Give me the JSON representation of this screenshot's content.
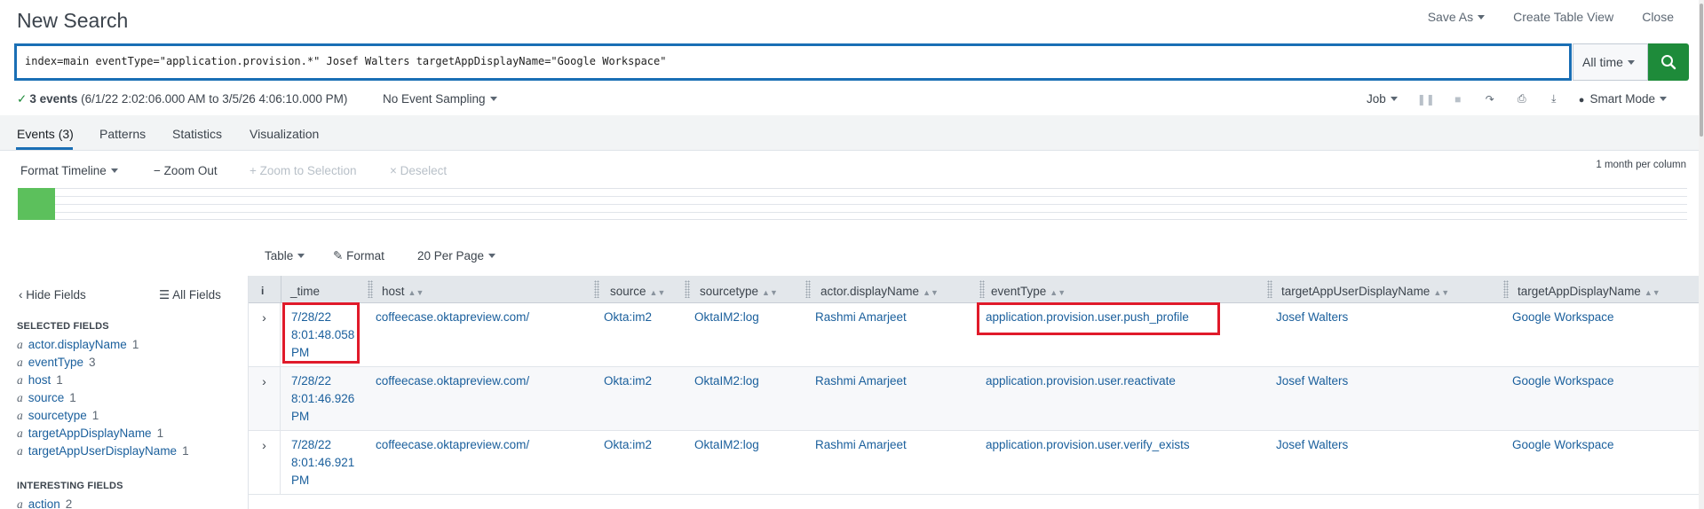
{
  "header": {
    "title": "New Search",
    "save_as": "Save As",
    "create_table_view": "Create Table View",
    "close": "Close"
  },
  "search": {
    "query": "index=main eventType=\"application.provision.*\" Josef Walters targetAppDisplayName=\"Google Workspace\"",
    "time_range": "All time"
  },
  "status": {
    "events_count": "3 events",
    "range": "(6/1/22 2:02:06.000 AM to 3/5/26 4:06:10.000 PM)",
    "sampling": "No Event Sampling",
    "job": "Job",
    "mode": "Smart Mode"
  },
  "tabs": [
    "Events (3)",
    "Patterns",
    "Statistics",
    "Visualization"
  ],
  "timeline": {
    "format": "Format Timeline",
    "zoom_out": "Zoom Out",
    "zoom_selection": "Zoom to Selection",
    "deselect": "Deselect",
    "per_column": "1 month per column"
  },
  "results_toolbar": {
    "view": "Table",
    "format": "Format",
    "per_page": "20 Per Page"
  },
  "fields_sidebar": {
    "hide": "Hide Fields",
    "all": "All Fields",
    "selected_title": "SELECTED FIELDS",
    "selected": [
      {
        "type": "a",
        "name": "actor.displayName",
        "count": "1"
      },
      {
        "type": "a",
        "name": "eventType",
        "count": "3"
      },
      {
        "type": "a",
        "name": "host",
        "count": "1"
      },
      {
        "type": "a",
        "name": "source",
        "count": "1"
      },
      {
        "type": "a",
        "name": "sourcetype",
        "count": "1"
      },
      {
        "type": "a",
        "name": "targetAppDisplayName",
        "count": "1"
      },
      {
        "type": "a",
        "name": "targetAppUserDisplayName",
        "count": "1"
      }
    ],
    "interesting_title": "INTERESTING FIELDS",
    "interesting": [
      {
        "type": "a",
        "name": "action",
        "count": "2"
      }
    ]
  },
  "table": {
    "info_header": "i",
    "columns": [
      "_time",
      "host",
      "source",
      "sourcetype",
      "actor.displayName",
      "eventType",
      "targetAppUserDisplayName",
      "targetAppDisplayName"
    ],
    "rows": [
      {
        "time": [
          "7/28/22",
          "8:01:48.058",
          "PM"
        ],
        "host": "coffeecase.oktapreview.com/",
        "source": "Okta:im2",
        "sourcetype": "OktaIM2:log",
        "actor": "Rashmi Amarjeet",
        "eventType": "application.provision.user.push_profile",
        "targetAppUser": "Josef Walters",
        "targetApp": "Google Workspace"
      },
      {
        "time": [
          "7/28/22",
          "8:01:46.926",
          "PM"
        ],
        "host": "coffeecase.oktapreview.com/",
        "source": "Okta:im2",
        "sourcetype": "OktaIM2:log",
        "actor": "Rashmi Amarjeet",
        "eventType": "application.provision.user.reactivate",
        "targetAppUser": "Josef Walters",
        "targetApp": "Google Workspace"
      },
      {
        "time": [
          "7/28/22",
          "8:01:46.921",
          "PM"
        ],
        "host": "coffeecase.oktapreview.com/",
        "source": "Okta:im2",
        "sourcetype": "OktaIM2:log",
        "actor": "Rashmi Amarjeet",
        "eventType": "application.provision.user.verify_exists",
        "targetAppUser": "Josef Walters",
        "targetApp": "Google Workspace"
      }
    ]
  },
  "colors": {
    "accent": "#1a6fb5",
    "search_button": "#1e8b3a",
    "timeline_bar": "#5cc05c",
    "highlight": "#e01a2a",
    "link": "#1a5f9c"
  }
}
